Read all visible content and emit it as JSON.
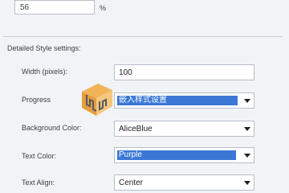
{
  "top_field": {
    "value": "56",
    "unit": "%"
  },
  "section": {
    "title": "Detailed Style settings:"
  },
  "rows": [
    {
      "label": "Width (pixels):",
      "value": "100"
    },
    {
      "label": "Progress",
      "value": "嵌入样式设置"
    },
    {
      "label": "Background Color:",
      "value": "AliceBlue"
    },
    {
      "label": "Text Color:",
      "value": "Purple"
    },
    {
      "label": "Text Align:",
      "value": "Center"
    }
  ],
  "colors": {
    "selection": "#3b78d6",
    "watermark": "#f2a93b"
  },
  "watermark": {
    "icon": "logo-watermark-icon"
  }
}
